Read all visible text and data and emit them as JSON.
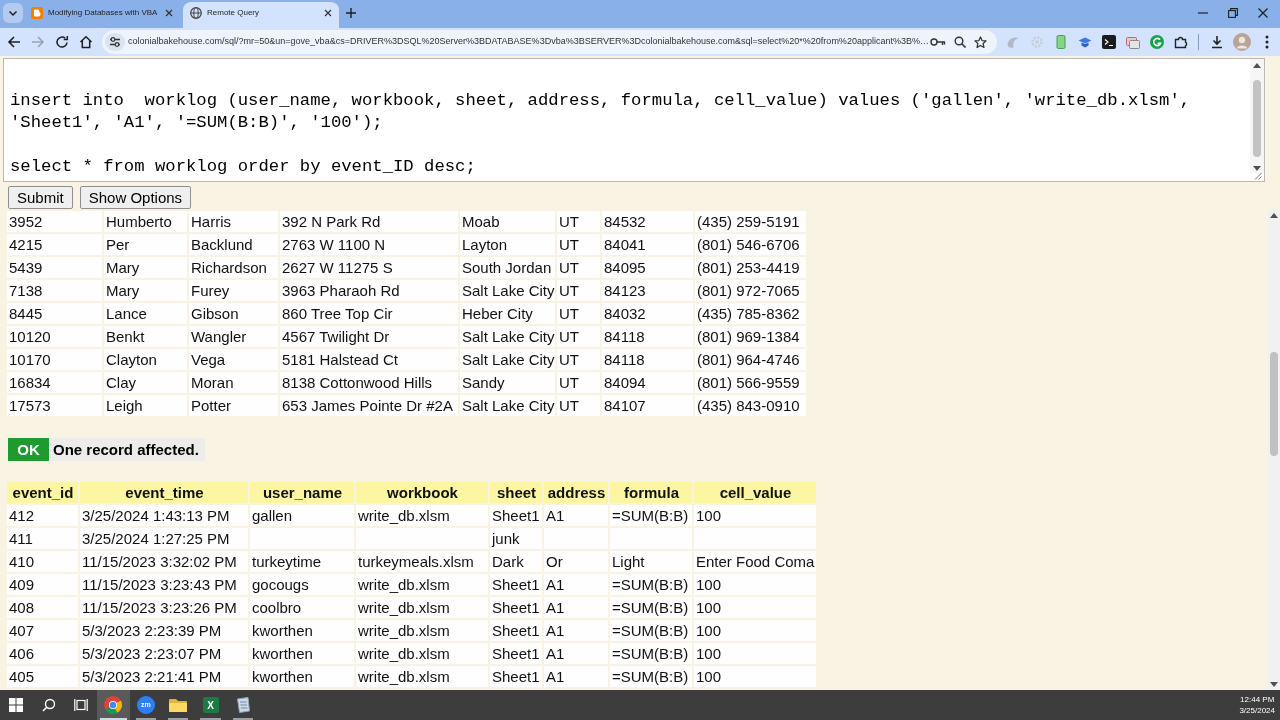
{
  "browser": {
    "tabs": [
      {
        "title": "Modifying Databases with VBA",
        "selected": false
      },
      {
        "title": "Remote Query",
        "selected": true
      }
    ],
    "navigation": {
      "back_disabled": false,
      "forward_disabled": true
    },
    "address_bar": {
      "url": "colonialbakehouse.com/sql/?mr=50&un=gove_vba&cs=DRIVER%3DSQL%20Server%3BDATABASE%3Dvba%3BSERVER%3Dcolonialbakehouse.com&sql=select%20*%20from%20applicant%3B%…"
    }
  },
  "query": {
    "text": "insert into  worklog (user_name, workbook, sheet, address, formula, cell_value) values ('gallen', 'write_db.xlsm', 'Sheet1', 'A1', '=SUM(B:B)', '100');\n\nselect * from worklog order by event_ID desc;"
  },
  "buttons": [
    {
      "label": "Submit"
    },
    {
      "label": "Show Options"
    }
  ],
  "results": [
    {
      "kind": "table",
      "rows": [
        [
          "3952",
          "Humberto",
          "Harris",
          "392 N Park Rd",
          "Moab",
          "UT",
          "84532",
          "(435) 259-5191"
        ],
        [
          "4215",
          "Per",
          "Backlund",
          "2763 W 1100 N",
          "Layton",
          "UT",
          "84041",
          "(801) 546-6706"
        ],
        [
          "5439",
          "Mary",
          "Richardson",
          "2627 W 11275 S",
          "South Jordan",
          "UT",
          "84095",
          "(801) 253-4419"
        ],
        [
          "7138",
          "Mary",
          "Furey",
          "3963 Pharaoh Rd",
          "Salt Lake City",
          "UT",
          "84123",
          "(801) 972-7065"
        ],
        [
          "8445",
          "Lance",
          "Gibson",
          "860 Tree Top Cir",
          "Heber City",
          "UT",
          "84032",
          "(435) 785-8362"
        ],
        [
          "10120",
          "Benkt",
          "Wangler",
          "4567 Twilight Dr",
          "Salt Lake City",
          "UT",
          "84118",
          "(801) 969-1384"
        ],
        [
          "10170",
          "Clayton",
          "Vega",
          "5181 Halstead Ct",
          "Salt Lake City",
          "UT",
          "84118",
          "(801) 964-4746"
        ],
        [
          "16834",
          "Clay",
          "Moran",
          "8138 Cottonwood Hills",
          "Sandy",
          "UT",
          "84094",
          "(801) 566-9559"
        ],
        [
          "17573",
          "Leigh",
          "Potter",
          "653 James Pointe Dr #2A",
          "Salt Lake City",
          "UT",
          "84107",
          "(435) 843-0910"
        ]
      ]
    },
    {
      "kind": "message",
      "badge": "OK",
      "success": true,
      "text": "One record affected."
    },
    {
      "kind": "table",
      "columns": [
        "event_id",
        "event_time",
        "user_name",
        "workbook",
        "sheet",
        "address",
        "formula",
        "cell_value"
      ],
      "rows": [
        [
          "412",
          "3/25/2024 1:43:13 PM",
          "gallen",
          "write_db.xlsm",
          "Sheet1",
          "A1",
          "=SUM(B:B)",
          "100"
        ],
        [
          "411",
          "3/25/2024 1:27:25 PM",
          null,
          null,
          "junk",
          null,
          null,
          null
        ],
        [
          "410",
          "11/15/2023 3:32:02 PM",
          "turkeytime",
          "turkeymeals.xlsm",
          "Dark",
          "Or",
          "Light",
          "Enter Food Coma"
        ],
        [
          "409",
          "11/15/2023 3:23:43 PM",
          "gocougs",
          "write_db.xlsm",
          "Sheet1",
          "A1",
          "=SUM(B:B)",
          "100"
        ],
        [
          "408",
          "11/15/2023 3:23:26 PM",
          "coolbro",
          "write_db.xlsm",
          "Sheet1",
          "A1",
          "=SUM(B:B)",
          "100"
        ],
        [
          "407",
          "5/3/2023 2:23:39 PM",
          "kworthen",
          "write_db.xlsm",
          "Sheet1",
          "A1",
          "=SUM(B:B)",
          "100"
        ],
        [
          "406",
          "5/3/2023 2:23:07 PM",
          "kworthen",
          "write_db.xlsm",
          "Sheet1",
          "A1",
          "=SUM(B:B)",
          "100"
        ],
        [
          "405",
          "5/3/2023 2:21:41 PM",
          "kworthen",
          "write_db.xlsm",
          "Sheet1",
          "A1",
          "=SUM(B:B)",
          "100"
        ]
      ]
    }
  ],
  "taskbar": {
    "apps": [
      {
        "running": true,
        "active": true
      },
      {
        "running": true,
        "active": false,
        "label": "zm"
      },
      {
        "running": true,
        "active": false
      },
      {
        "running": true,
        "active": false,
        "label": "X"
      },
      {
        "running": true,
        "active": false
      }
    ],
    "clock": {
      "time": "12:44 PM",
      "date": "3/25/2024"
    }
  }
}
